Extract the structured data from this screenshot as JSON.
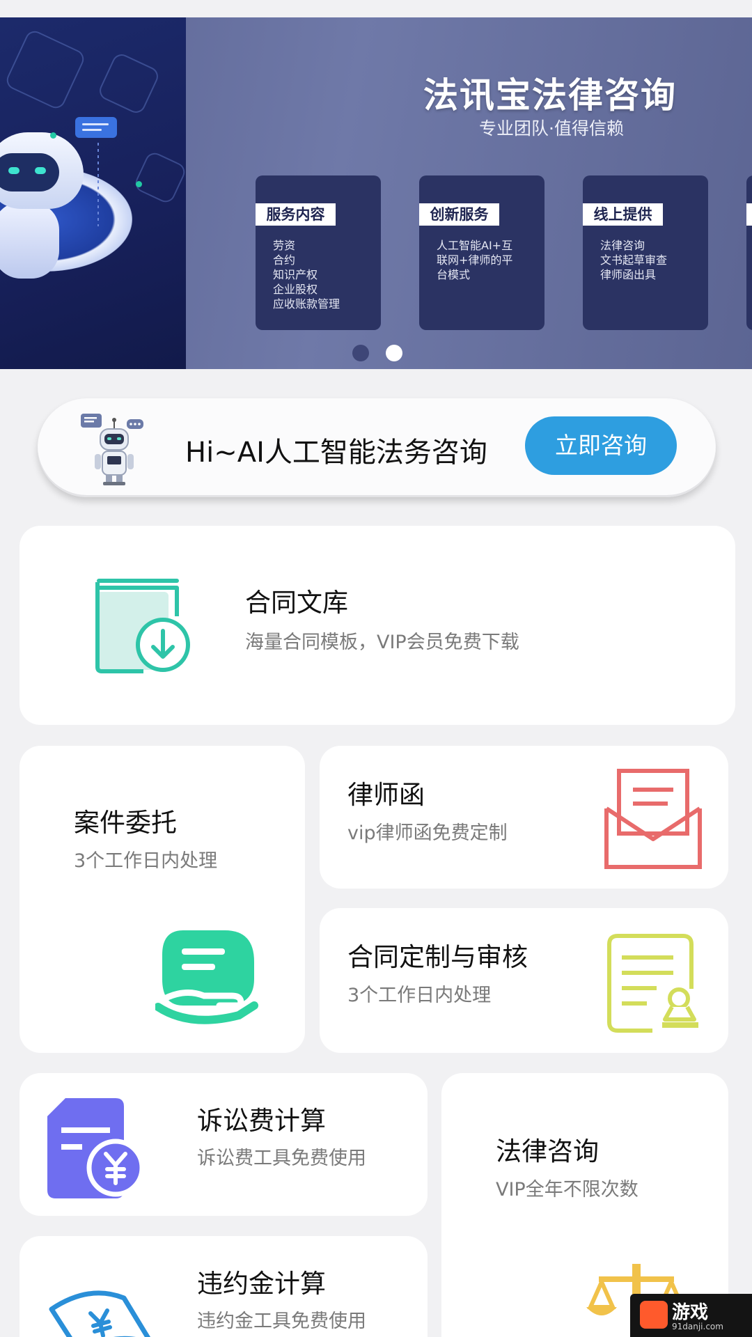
{
  "banner": {
    "title": "法讯宝法律咨询",
    "subtitle": "专业团队·值得信赖",
    "cards": [
      {
        "label": "服务内容",
        "lines": [
          "劳资",
          "合约",
          "知识产权",
          "企业股权",
          "应收账款管理"
        ]
      },
      {
        "label": "创新服务",
        "lines": [
          "人工智能AI+互",
          "联网+律师的平",
          "台模式"
        ]
      },
      {
        "label": "线上提供",
        "lines": [
          "法律咨询",
          "文书起草审查",
          "律师函出具"
        ]
      }
    ],
    "pager": {
      "count": 2,
      "active": 2
    }
  },
  "ai_bar": {
    "text": "Hi~AI人工智能法务咨询",
    "button": "立即咨询"
  },
  "services": {
    "contract_library": {
      "title": "合同文库",
      "subtitle": "海量合同模板，VIP会员免费下载",
      "icon": "book-download-icon",
      "color": "#2ec4a8"
    },
    "case_entrust": {
      "title": "案件委托",
      "subtitle": "3个工作日内处理",
      "icon": "hand-document-icon",
      "color": "#2ed3a0"
    },
    "lawyer_letter": {
      "title": "律师函",
      "subtitle": "vip律师函免费定制",
      "icon": "envelope-letter-icon",
      "color": "#e86b6b"
    },
    "contract_review": {
      "title": "合同定制与审核",
      "subtitle": "3个工作日内处理",
      "icon": "document-stamp-icon",
      "color": "#d3dd5a"
    },
    "litigation_fee": {
      "title": "诉讼费计算",
      "subtitle": "诉讼费工具免费使用",
      "icon": "yuan-document-icon",
      "color": "#6f6ef0"
    },
    "legal_consult": {
      "title": "法律咨询",
      "subtitle": "VIP全年不限次数",
      "icon": "scales-icon",
      "color": "#f1c24a"
    },
    "penalty_calc": {
      "title": "违约金计算",
      "subtitle": "违约金工具免费使用",
      "icon": "yuan-banknote-icon",
      "color": "#2a8fd8"
    }
  },
  "watermark": {
    "main": "游戏",
    "sub": "91danji.com"
  }
}
